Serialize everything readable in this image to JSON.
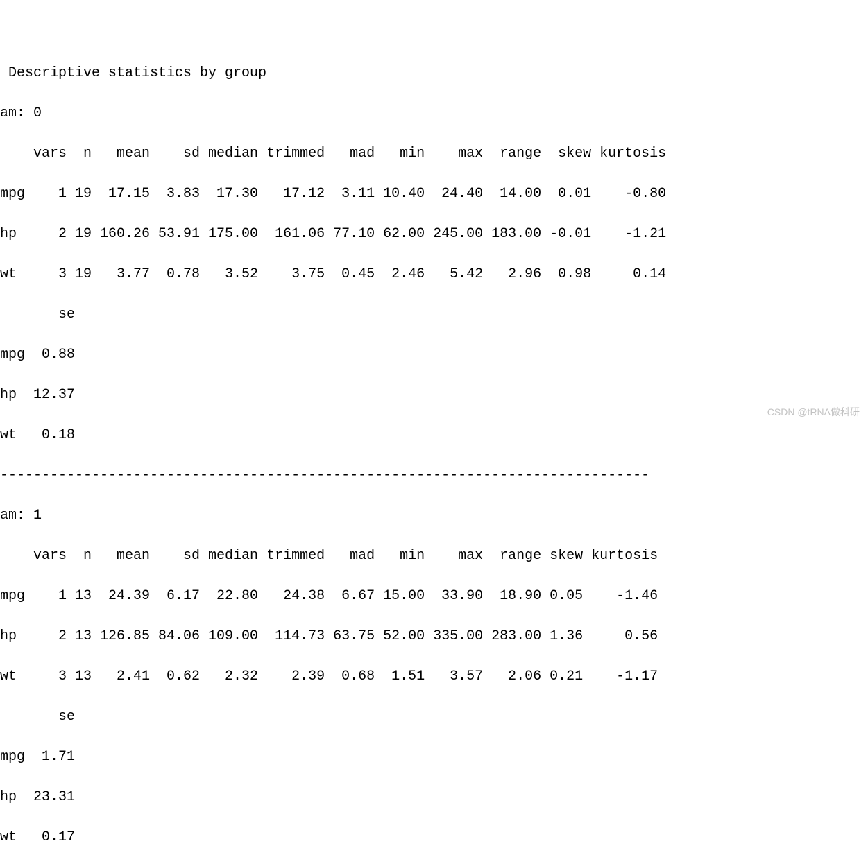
{
  "title": " Descriptive statistics by group ",
  "groups": [
    {
      "label": "am: 0",
      "header": "    vars  n   mean    sd median trimmed   mad   min    max  range  skew kurtosis",
      "rows": [
        {
          "name": "mpg",
          "vars": 1,
          "n": 19,
          "mean": 17.15,
          "sd": 3.83,
          "median": 17.3,
          "trimmed": 17.12,
          "mad": 3.11,
          "min": 10.4,
          "max": 24.4,
          "range": 14.0,
          "skew": 0.01,
          "kurtosis": -0.8,
          "line": "mpg    1 19  17.15  3.83  17.30   17.12  3.11 10.40  24.40  14.00  0.01    -0.80"
        },
        {
          "name": "hp",
          "vars": 2,
          "n": 19,
          "mean": 160.26,
          "sd": 53.91,
          "median": 175.0,
          "trimmed": 161.06,
          "mad": 77.1,
          "min": 62.0,
          "max": 245.0,
          "range": 183.0,
          "skew": -0.01,
          "kurtosis": -1.21,
          "line": "hp     2 19 160.26 53.91 175.00  161.06 77.10 62.00 245.00 183.00 -0.01    -1.21"
        },
        {
          "name": "wt",
          "vars": 3,
          "n": 19,
          "mean": 3.77,
          "sd": 0.78,
          "median": 3.52,
          "trimmed": 3.75,
          "mad": 0.45,
          "min": 2.46,
          "max": 5.42,
          "range": 2.96,
          "skew": 0.98,
          "kurtosis": 0.14,
          "line": "wt     3 19   3.77  0.78   3.52    3.75  0.45  2.46   5.42   2.96  0.98     0.14"
        }
      ],
      "se_header": "       se",
      "se_rows": [
        {
          "name": "mpg",
          "se": 0.88,
          "line": "mpg  0.88"
        },
        {
          "name": "hp",
          "se": 12.37,
          "line": "hp  12.37"
        },
        {
          "name": "wt",
          "se": 0.18,
          "line": "wt   0.18"
        }
      ]
    },
    {
      "label": "am: 1",
      "header": "    vars  n   mean    sd median trimmed   mad   min    max  range skew kurtosis",
      "rows": [
        {
          "name": "mpg",
          "vars": 1,
          "n": 13,
          "mean": 24.39,
          "sd": 6.17,
          "median": 22.8,
          "trimmed": 24.38,
          "mad": 6.67,
          "min": 15.0,
          "max": 33.9,
          "range": 18.9,
          "skew": 0.05,
          "kurtosis": -1.46,
          "line": "mpg    1 13  24.39  6.17  22.80   24.38  6.67 15.00  33.90  18.90 0.05    -1.46"
        },
        {
          "name": "hp",
          "vars": 2,
          "n": 13,
          "mean": 126.85,
          "sd": 84.06,
          "median": 109.0,
          "trimmed": 114.73,
          "mad": 63.75,
          "min": 52.0,
          "max": 335.0,
          "range": 283.0,
          "skew": 1.36,
          "kurtosis": 0.56,
          "line": "hp     2 13 126.85 84.06 109.00  114.73 63.75 52.00 335.00 283.00 1.36     0.56"
        },
        {
          "name": "wt",
          "vars": 3,
          "n": 13,
          "mean": 2.41,
          "sd": 0.62,
          "median": 2.32,
          "trimmed": 2.39,
          "mad": 0.68,
          "min": 1.51,
          "max": 3.57,
          "range": 2.06,
          "skew": 0.21,
          "kurtosis": -1.17,
          "line": "wt     3 13   2.41  0.62   2.32    2.39  0.68  1.51   3.57   2.06 0.21    -1.17"
        }
      ],
      "se_header": "       se",
      "se_rows": [
        {
          "name": "mpg",
          "se": 1.71,
          "line": "mpg  1.71"
        },
        {
          "name": "hp",
          "se": 23.31,
          "line": "hp  23.31"
        },
        {
          "name": "wt",
          "se": 0.17,
          "line": "wt   0.17"
        }
      ]
    }
  ],
  "separator": "------------------------------------------------------------------------------ ",
  "watermark": "CSDN @tRNA做科研"
}
